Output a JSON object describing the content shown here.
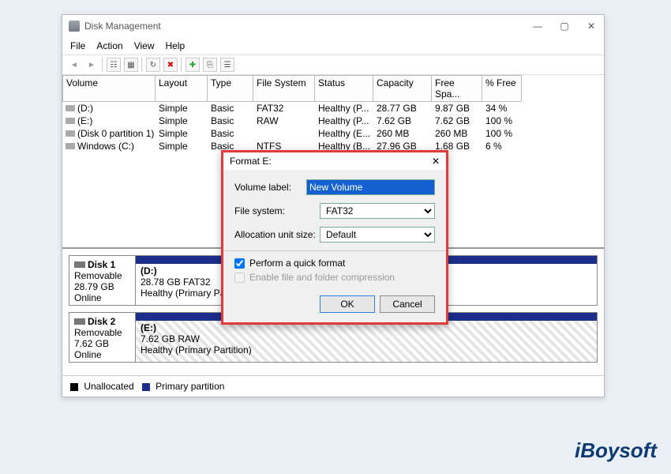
{
  "window": {
    "title": "Disk Management",
    "controls": {
      "min": "—",
      "max": "▢",
      "close": "✕"
    },
    "menus": [
      "File",
      "Action",
      "View",
      "Help"
    ]
  },
  "toolbar_icons": [
    "back",
    "fwd",
    "sep",
    "tree",
    "props",
    "sep",
    "refresh",
    "delete",
    "sep",
    "new",
    "plug",
    "options"
  ],
  "columns": [
    "Volume",
    "Layout",
    "Type",
    "File System",
    "Status",
    "Capacity",
    "Free Spa...",
    "% Free"
  ],
  "volumes": [
    {
      "name": "(D:)",
      "layout": "Simple",
      "type": "Basic",
      "fs": "FAT32",
      "status": "Healthy (P...",
      "cap": "28.77 GB",
      "free": "9.87 GB",
      "pct": "34 %"
    },
    {
      "name": "(E:)",
      "layout": "Simple",
      "type": "Basic",
      "fs": "RAW",
      "status": "Healthy (P...",
      "cap": "7.62 GB",
      "free": "7.62 GB",
      "pct": "100 %"
    },
    {
      "name": "(Disk 0 partition 1)",
      "layout": "Simple",
      "type": "Basic",
      "fs": "",
      "status": "Healthy (E...",
      "cap": "260 MB",
      "free": "260 MB",
      "pct": "100 %"
    },
    {
      "name": "Windows (C:)",
      "layout": "Simple",
      "type": "Basic",
      "fs": "NTFS",
      "status": "Healthy (B...",
      "cap": "27.96 GB",
      "free": "1.68 GB",
      "pct": "6 %"
    }
  ],
  "disks": [
    {
      "label": "Disk 1",
      "kind": "Removable",
      "size": "28.79 GB",
      "state": "Online",
      "part": {
        "title": "(D:)",
        "sub": "28.78 GB FAT32",
        "health": "Healthy (Primary Partition)",
        "hatched": false
      }
    },
    {
      "label": "Disk 2",
      "kind": "Removable",
      "size": "7.62 GB",
      "state": "Online",
      "part": {
        "title": "(E:)",
        "sub": "7.62 GB RAW",
        "health": "Healthy (Primary Partition)",
        "hatched": true
      }
    }
  ],
  "legend": {
    "unallocated": "Unallocated",
    "primary": "Primary partition"
  },
  "dialog": {
    "title": "Format E:",
    "fields": {
      "volume_label_label": "Volume label:",
      "volume_label_value": "New Volume",
      "file_system_label": "File system:",
      "file_system_value": "FAT32",
      "alloc_label": "Allocation unit size:",
      "alloc_value": "Default"
    },
    "check_quick": "Perform a quick format",
    "check_quick_on": true,
    "check_compress": "Enable file and folder compression",
    "ok": "OK",
    "cancel": "Cancel"
  },
  "watermark": "iBoysoft"
}
